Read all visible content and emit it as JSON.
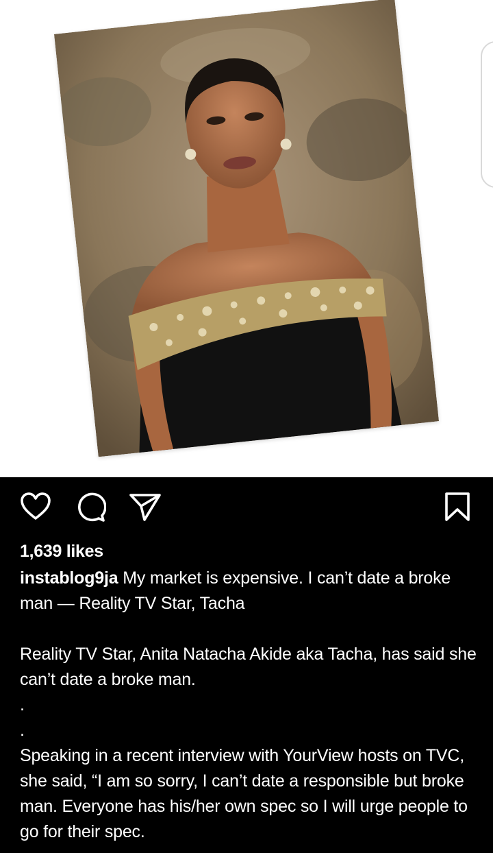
{
  "post": {
    "image_alt": "Portrait photo of a woman in a black off-shoulder dress with embellished neckline",
    "likes": "1,639 likes",
    "username": "instablog9ja",
    "caption_lines": {
      "headline": "My market is expensive. I can’t date a broke man — Reality TV Star, Tacha",
      "para1": "Reality TV Star, Anita Natacha Akide aka Tacha, has said she can’t date a broke man.",
      "dot1": ".",
      "dot2": ".",
      "para2": "Speaking in a recent interview with YourView hosts on TVC, she said, “I am so sorry, I can’t date a responsible but broke man. Everyone has his/her own spec so I will urge people to go for their spec."
    }
  },
  "actions": {
    "like_icon": "heart-icon",
    "comment_icon": "comment-icon",
    "share_icon": "send-icon",
    "save_icon": "bookmark-icon"
  },
  "colors": {
    "background": "#000000",
    "text": "#ffffff"
  }
}
